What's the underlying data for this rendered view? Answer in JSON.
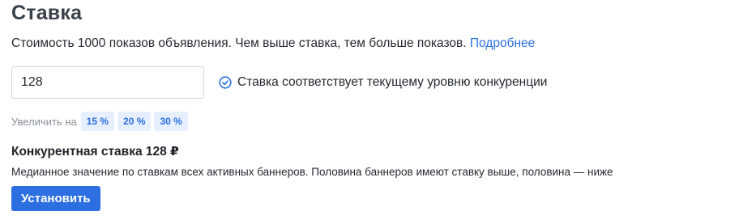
{
  "page": {
    "title": "Ставка",
    "description": "Стоимость 1000 показов объявления. Чем выше ставка, тем больше показов.",
    "more_link": "Подробнее"
  },
  "bid_input": {
    "value": "128"
  },
  "status": {
    "icon": "check-circle-icon",
    "text": "Ставка соответствует текущему уровню конкуренции",
    "color": "#2b6fe0"
  },
  "increase": {
    "label": "Увеличить на",
    "options": [
      "15 %",
      "20 %",
      "30 %"
    ]
  },
  "competitive": {
    "title": "Конкурентная ставка 128 ₽",
    "description": "Медианное значение по ставкам всех активных баннеров. Половина баннеров имеют ставку выше, половина — ниже"
  },
  "actions": {
    "set_label": "Установить"
  },
  "colors": {
    "accent": "#2b6fe0",
    "chip_bg": "#e6efff"
  }
}
